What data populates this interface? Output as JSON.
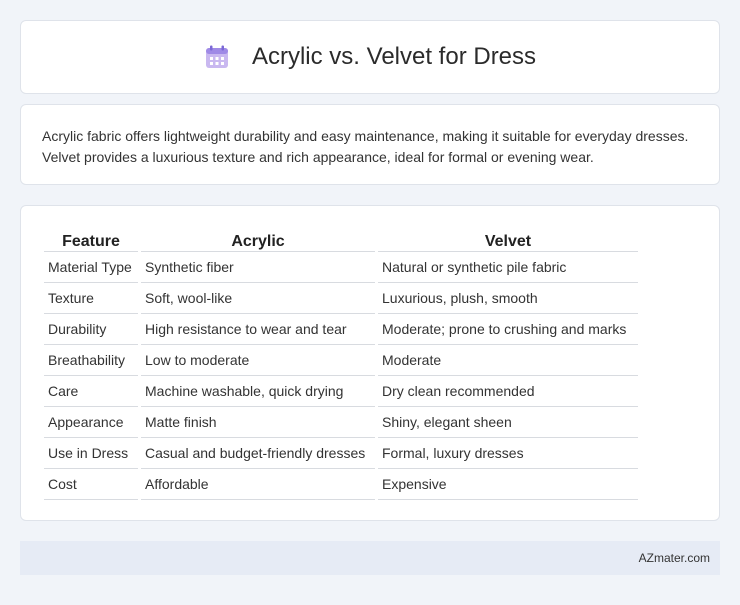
{
  "header": {
    "title": "Acrylic vs. Velvet for Dress",
    "icon": "calendar-icon"
  },
  "intro": {
    "text": "Acrylic fabric offers lightweight durability and easy maintenance, making it suitable for everyday dresses. Velvet provides a luxurious texture and rich appearance, ideal for formal or evening wear."
  },
  "table": {
    "headers": [
      "Feature",
      "Acrylic",
      "Velvet"
    ],
    "rows": [
      [
        "Material Type",
        "Synthetic fiber",
        "Natural or synthetic pile fabric"
      ],
      [
        "Texture",
        "Soft, wool-like",
        "Luxurious, plush, smooth"
      ],
      [
        "Durability",
        "High resistance to wear and tear",
        "Moderate; prone to crushing and marks"
      ],
      [
        "Breathability",
        "Low to moderate",
        "Moderate"
      ],
      [
        "Care",
        "Machine washable, quick drying",
        "Dry clean recommended"
      ],
      [
        "Appearance",
        "Matte finish",
        "Shiny, elegant sheen"
      ],
      [
        "Use in Dress",
        "Casual and budget-friendly dresses",
        "Formal, luxury dresses"
      ],
      [
        "Cost",
        "Affordable",
        "Expensive"
      ]
    ]
  },
  "footer": {
    "brand": "AZmater.com"
  }
}
